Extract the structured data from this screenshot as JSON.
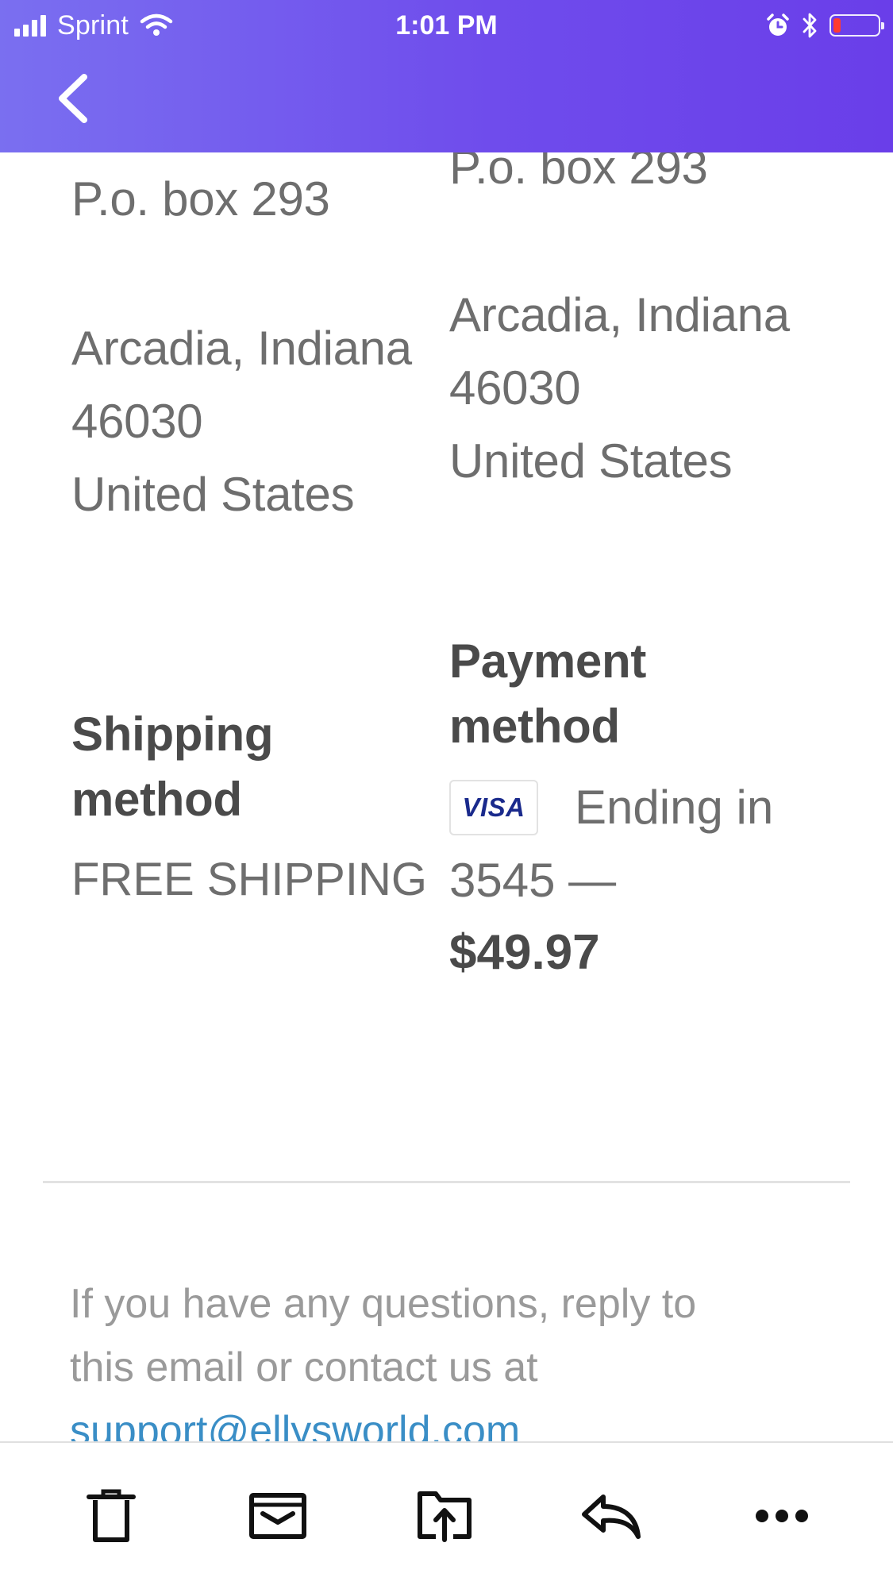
{
  "status_bar": {
    "carrier": "Sprint",
    "time": "1:01 PM"
  },
  "shipping_address": {
    "line1": "P.o. box 293",
    "city_state": "Arcadia, Indiana",
    "zip": "46030",
    "country": "United States"
  },
  "billing_address": {
    "line1": "P.o. box 293",
    "city_state": "Arcadia, Indiana",
    "zip": "46030",
    "country": "United States"
  },
  "shipping_method": {
    "title_line1": "Shipping",
    "title_line2": "method",
    "value": "FREE SHIPPING"
  },
  "payment_method": {
    "title_line1": "Payment",
    "title_line2": "method",
    "card_brand": "VISA",
    "ending_text": "Ending in",
    "last4_text": "3545 —",
    "amount": "$49.97"
  },
  "footer": {
    "line1": "If you have any questions, reply to",
    "line2": "this email or contact us at",
    "email": "support@ellysworld.com"
  },
  "colors": {
    "header_gradient_start": "#7a6ff0",
    "header_gradient_end": "#6a3ee9",
    "link": "#3a8ec6",
    "battery_low": "#ff3b30"
  },
  "icons": {
    "back": "chevron-left-icon",
    "trash": "trash-icon",
    "archive": "archive-icon",
    "move": "folder-move-icon",
    "reply": "reply-icon",
    "more": "more-icon"
  }
}
